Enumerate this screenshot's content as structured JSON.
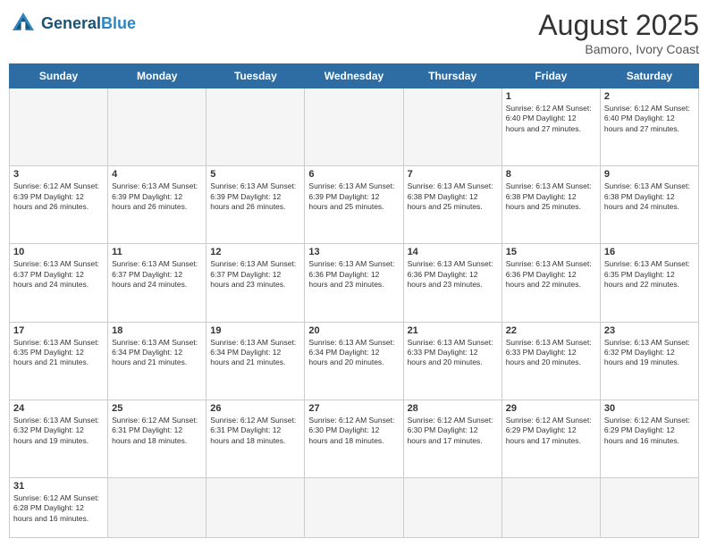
{
  "header": {
    "logo_general": "General",
    "logo_blue": "Blue",
    "month_title": "August 2025",
    "subtitle": "Bamoro, Ivory Coast"
  },
  "days_of_week": [
    "Sunday",
    "Monday",
    "Tuesday",
    "Wednesday",
    "Thursday",
    "Friday",
    "Saturday"
  ],
  "weeks": [
    [
      {
        "day": "",
        "info": ""
      },
      {
        "day": "",
        "info": ""
      },
      {
        "day": "",
        "info": ""
      },
      {
        "day": "",
        "info": ""
      },
      {
        "day": "",
        "info": ""
      },
      {
        "day": "1",
        "info": "Sunrise: 6:12 AM\nSunset: 6:40 PM\nDaylight: 12 hours and 27 minutes."
      },
      {
        "day": "2",
        "info": "Sunrise: 6:12 AM\nSunset: 6:40 PM\nDaylight: 12 hours and 27 minutes."
      }
    ],
    [
      {
        "day": "3",
        "info": "Sunrise: 6:12 AM\nSunset: 6:39 PM\nDaylight: 12 hours and 26 minutes."
      },
      {
        "day": "4",
        "info": "Sunrise: 6:13 AM\nSunset: 6:39 PM\nDaylight: 12 hours and 26 minutes."
      },
      {
        "day": "5",
        "info": "Sunrise: 6:13 AM\nSunset: 6:39 PM\nDaylight: 12 hours and 26 minutes."
      },
      {
        "day": "6",
        "info": "Sunrise: 6:13 AM\nSunset: 6:39 PM\nDaylight: 12 hours and 25 minutes."
      },
      {
        "day": "7",
        "info": "Sunrise: 6:13 AM\nSunset: 6:38 PM\nDaylight: 12 hours and 25 minutes."
      },
      {
        "day": "8",
        "info": "Sunrise: 6:13 AM\nSunset: 6:38 PM\nDaylight: 12 hours and 25 minutes."
      },
      {
        "day": "9",
        "info": "Sunrise: 6:13 AM\nSunset: 6:38 PM\nDaylight: 12 hours and 24 minutes."
      }
    ],
    [
      {
        "day": "10",
        "info": "Sunrise: 6:13 AM\nSunset: 6:37 PM\nDaylight: 12 hours and 24 minutes."
      },
      {
        "day": "11",
        "info": "Sunrise: 6:13 AM\nSunset: 6:37 PM\nDaylight: 12 hours and 24 minutes."
      },
      {
        "day": "12",
        "info": "Sunrise: 6:13 AM\nSunset: 6:37 PM\nDaylight: 12 hours and 23 minutes."
      },
      {
        "day": "13",
        "info": "Sunrise: 6:13 AM\nSunset: 6:36 PM\nDaylight: 12 hours and 23 minutes."
      },
      {
        "day": "14",
        "info": "Sunrise: 6:13 AM\nSunset: 6:36 PM\nDaylight: 12 hours and 23 minutes."
      },
      {
        "day": "15",
        "info": "Sunrise: 6:13 AM\nSunset: 6:36 PM\nDaylight: 12 hours and 22 minutes."
      },
      {
        "day": "16",
        "info": "Sunrise: 6:13 AM\nSunset: 6:35 PM\nDaylight: 12 hours and 22 minutes."
      }
    ],
    [
      {
        "day": "17",
        "info": "Sunrise: 6:13 AM\nSunset: 6:35 PM\nDaylight: 12 hours and 21 minutes."
      },
      {
        "day": "18",
        "info": "Sunrise: 6:13 AM\nSunset: 6:34 PM\nDaylight: 12 hours and 21 minutes."
      },
      {
        "day": "19",
        "info": "Sunrise: 6:13 AM\nSunset: 6:34 PM\nDaylight: 12 hours and 21 minutes."
      },
      {
        "day": "20",
        "info": "Sunrise: 6:13 AM\nSunset: 6:34 PM\nDaylight: 12 hours and 20 minutes."
      },
      {
        "day": "21",
        "info": "Sunrise: 6:13 AM\nSunset: 6:33 PM\nDaylight: 12 hours and 20 minutes."
      },
      {
        "day": "22",
        "info": "Sunrise: 6:13 AM\nSunset: 6:33 PM\nDaylight: 12 hours and 20 minutes."
      },
      {
        "day": "23",
        "info": "Sunrise: 6:13 AM\nSunset: 6:32 PM\nDaylight: 12 hours and 19 minutes."
      }
    ],
    [
      {
        "day": "24",
        "info": "Sunrise: 6:13 AM\nSunset: 6:32 PM\nDaylight: 12 hours and 19 minutes."
      },
      {
        "day": "25",
        "info": "Sunrise: 6:12 AM\nSunset: 6:31 PM\nDaylight: 12 hours and 18 minutes."
      },
      {
        "day": "26",
        "info": "Sunrise: 6:12 AM\nSunset: 6:31 PM\nDaylight: 12 hours and 18 minutes."
      },
      {
        "day": "27",
        "info": "Sunrise: 6:12 AM\nSunset: 6:30 PM\nDaylight: 12 hours and 18 minutes."
      },
      {
        "day": "28",
        "info": "Sunrise: 6:12 AM\nSunset: 6:30 PM\nDaylight: 12 hours and 17 minutes."
      },
      {
        "day": "29",
        "info": "Sunrise: 6:12 AM\nSunset: 6:29 PM\nDaylight: 12 hours and 17 minutes."
      },
      {
        "day": "30",
        "info": "Sunrise: 6:12 AM\nSunset: 6:29 PM\nDaylight: 12 hours and 16 minutes."
      }
    ],
    [
      {
        "day": "31",
        "info": "Sunrise: 6:12 AM\nSunset: 6:28 PM\nDaylight: 12 hours and 16 minutes."
      },
      {
        "day": "",
        "info": ""
      },
      {
        "day": "",
        "info": ""
      },
      {
        "day": "",
        "info": ""
      },
      {
        "day": "",
        "info": ""
      },
      {
        "day": "",
        "info": ""
      },
      {
        "day": "",
        "info": ""
      }
    ]
  ]
}
